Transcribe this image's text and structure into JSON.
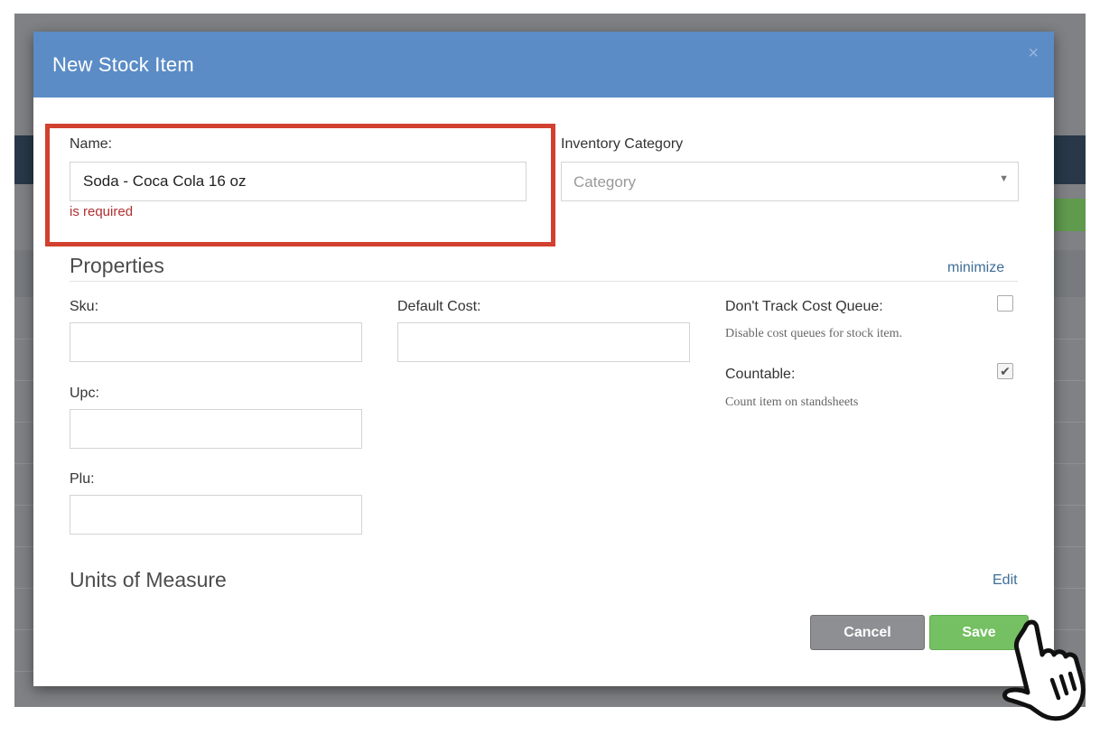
{
  "modal": {
    "title": "New Stock Item",
    "close_icon": "×"
  },
  "name_field": {
    "label": "Name:",
    "value": "Soda - Coca Cola 16 oz",
    "error": "is required"
  },
  "inventory_category": {
    "label": "Inventory Category",
    "placeholder": "Category",
    "arrow": "▼"
  },
  "properties": {
    "title": "Properties",
    "minimize_link": "minimize",
    "sku_label": "Sku:",
    "sku_value": "",
    "upc_label": "Upc:",
    "upc_value": "",
    "plu_label": "Plu:",
    "plu_value": "",
    "default_cost_label": "Default Cost:",
    "default_cost_value": "",
    "dont_track": {
      "label": "Don't Track Cost Queue:",
      "help": "Disable cost queues for stock item.",
      "checked": false
    },
    "countable": {
      "label": "Countable:",
      "help": "Count item on standsheets",
      "checked": true,
      "check_glyph": "✔"
    }
  },
  "units": {
    "title": "Units of Measure",
    "edit_link": "Edit"
  },
  "buttons": {
    "cancel": "Cancel",
    "save": "Save"
  },
  "icons": {
    "close": "close-icon",
    "dropdown": "chevron-down-icon",
    "cursor": "hand-pointer-icon"
  },
  "colors": {
    "header": "#5b8cc6",
    "highlight": "#d2402f",
    "error": "#b03030",
    "save": "#74c062",
    "cancel": "#8e8f92",
    "link": "#3f6f96"
  }
}
